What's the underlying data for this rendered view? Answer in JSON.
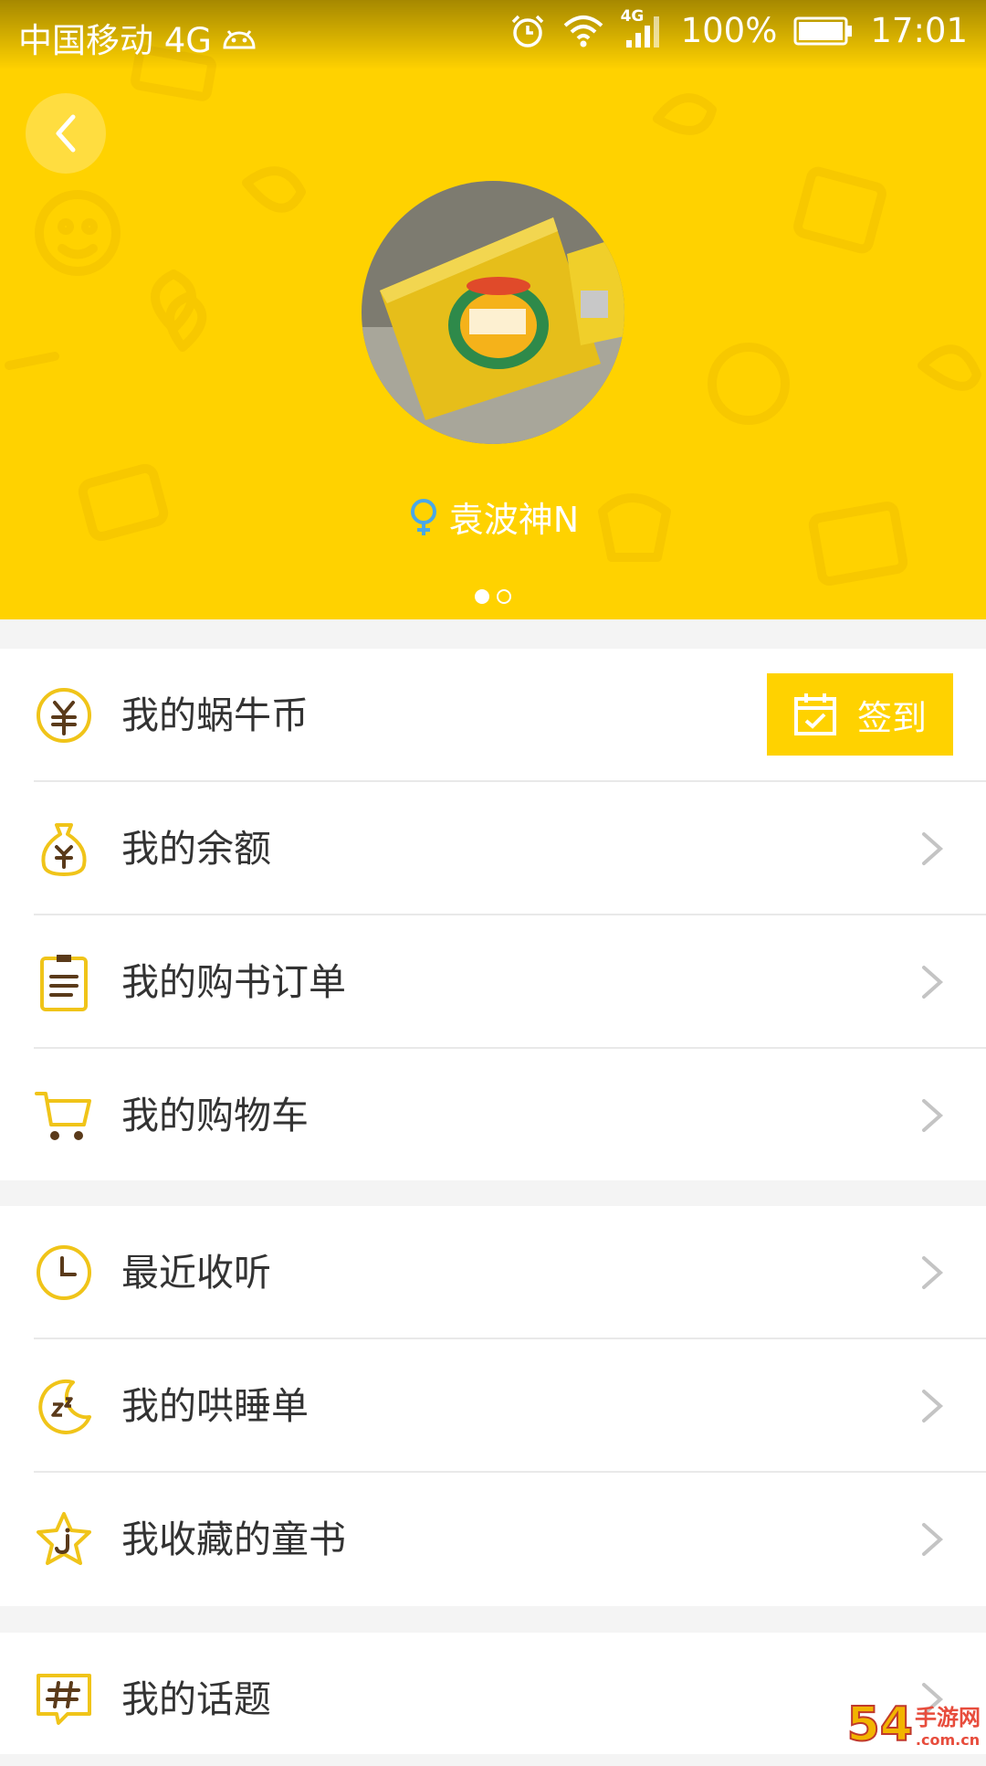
{
  "status_bar": {
    "carrier": "中国移动 4G",
    "network_badge": "4G",
    "battery": "100%",
    "time": "17:01"
  },
  "profile": {
    "username": "袁波神N",
    "gender_icon": "female-icon",
    "carousel_pages": 2,
    "carousel_active": 1
  },
  "menu_section_1": [
    {
      "label": "我的蜗牛币",
      "icon": "coin-icon"
    },
    {
      "label": "我的余额",
      "icon": "money-bag-icon"
    },
    {
      "label": "我的购书订单",
      "icon": "clipboard-icon"
    },
    {
      "label": "我的购物车",
      "icon": "cart-icon"
    }
  ],
  "signin_button": {
    "label": "签到",
    "icon": "calendar-check-icon"
  },
  "menu_section_2": [
    {
      "label": "最近收听",
      "icon": "clock-icon"
    },
    {
      "label": "我的哄睡单",
      "icon": "moon-sleep-icon"
    },
    {
      "label": "我收藏的童书",
      "icon": "star-icon"
    }
  ],
  "menu_section_3": [
    {
      "label": "我的话题",
      "icon": "hashtag-icon"
    }
  ],
  "watermark": {
    "brand": "54",
    "site": "手游网",
    "domain": ".com.cn"
  },
  "colors": {
    "accent": "#ffd200",
    "icon_stroke": "#f0c419",
    "icon_detail": "#5a3a1a",
    "text": "#333333",
    "chevron": "#c4c4c4"
  }
}
